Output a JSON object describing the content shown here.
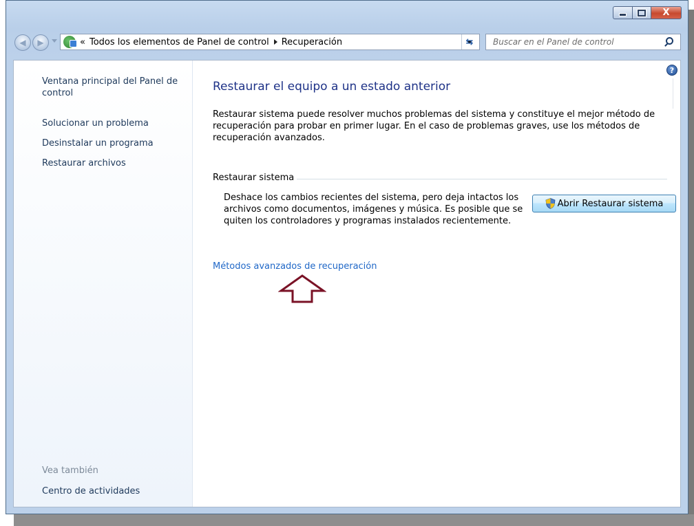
{
  "window": {
    "buttons": {
      "minimize_icon": "minimize-icon",
      "maximize_icon": "maximize-icon",
      "close_label": "X"
    }
  },
  "navigation": {
    "back_icon": "back-arrow-icon",
    "forward_icon": "forward-arrow-icon",
    "address": {
      "overflow_chevron": "«",
      "breadcrumbs": [
        "Todos los elementos de Panel de control",
        "Recuperación"
      ]
    },
    "refresh_glyph": "⇆",
    "search_placeholder": "Buscar en el Panel de control"
  },
  "sidebar": {
    "links": [
      "Ventana principal del Panel de control",
      "Solucionar un problema",
      "Desinstalar un programa",
      "Restaurar archivos"
    ],
    "see_also_heading": "Vea también",
    "see_also_links": [
      "Centro de actividades"
    ]
  },
  "main": {
    "help_glyph": "?",
    "title": "Restaurar el equipo a un estado anterior",
    "intro": "Restaurar sistema puede resolver muchos problemas del sistema y constituye el mejor método de recuperación para probar en primer lugar. En el caso de problemas graves, use los métodos de recuperación avanzados.",
    "restore_group": {
      "label": "Restaurar sistema",
      "description": "Deshace los cambios recientes del sistema, pero deja intactos los archivos como documentos, imágenes y música. Es posible que se quiten los controladores y programas instalados recientemente.",
      "button_label": "Abrir Restaurar sistema",
      "button_icon": "uac-shield-icon"
    },
    "advanced_link": "Métodos avanzados de recuperación",
    "annotation_icon": "up-arrow-outline-icon",
    "annotation_color": "#7a1226"
  },
  "colors": {
    "title": "#1e3287",
    "link": "#1f67c7",
    "sidebar_link": "#1e395b",
    "muted": "#7d8a99"
  }
}
